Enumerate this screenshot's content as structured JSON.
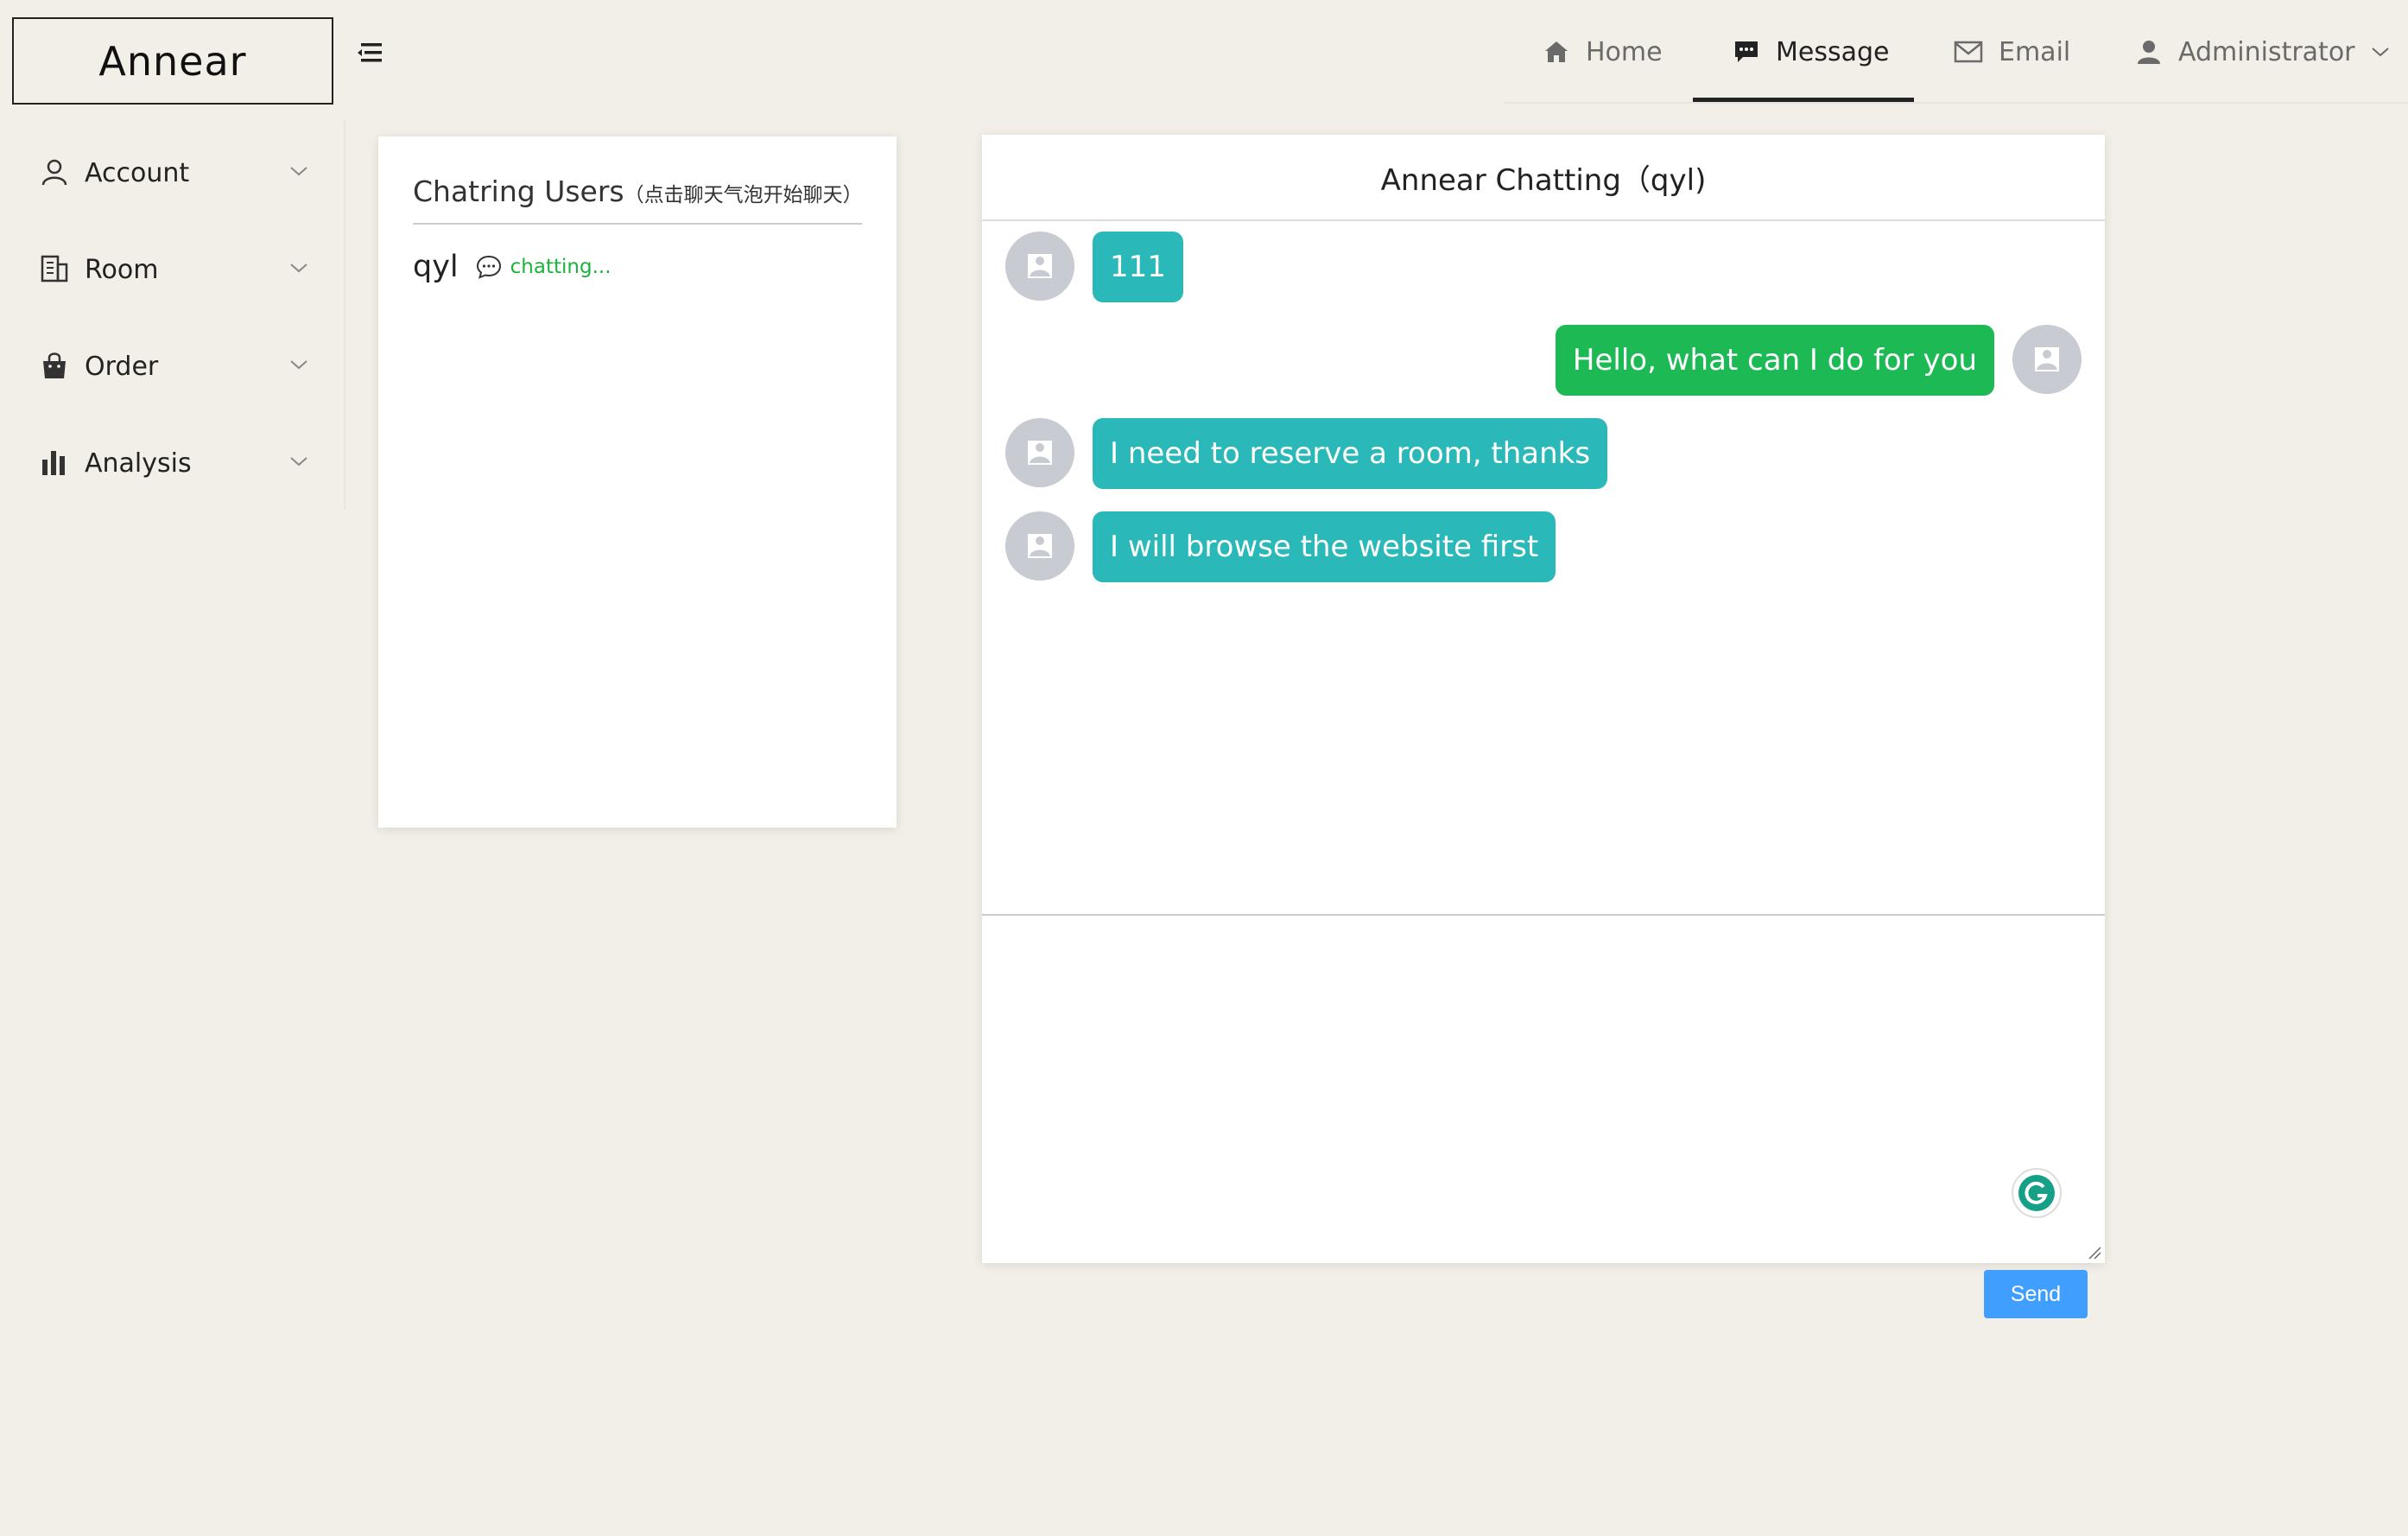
{
  "brand": {
    "logo_text": "Annear"
  },
  "topnav": {
    "items": [
      {
        "label": "Home",
        "icon": "home-icon"
      },
      {
        "label": "Message",
        "icon": "message-icon",
        "active": true
      },
      {
        "label": "Email",
        "icon": "mail-icon"
      },
      {
        "label": "Administrator",
        "icon": "user-icon"
      }
    ]
  },
  "sidebar": {
    "items": [
      {
        "label": "Account",
        "icon": "user-outline-icon"
      },
      {
        "label": "Room",
        "icon": "building-icon"
      },
      {
        "label": "Order",
        "icon": "shopping-bag-icon"
      },
      {
        "label": "Analysis",
        "icon": "bar-chart-icon"
      }
    ]
  },
  "users_panel": {
    "title": "Chatring Users",
    "subtitle": "（点击聊天气泡开始聊天）",
    "users": [
      {
        "name": "qyl",
        "status": "chatting..."
      }
    ]
  },
  "chat": {
    "title": "Annear Chatting（qyl)",
    "messages": [
      {
        "direction": "in",
        "text": "111"
      },
      {
        "direction": "out",
        "text": "Hello, what can I do for you"
      },
      {
        "direction": "in",
        "text": "I need to reserve a room, thanks"
      },
      {
        "direction": "in",
        "text": "I will browse the website first"
      }
    ],
    "input_value": "",
    "send_label": "Send"
  },
  "colors": {
    "background": "#f2eee8",
    "incoming_bubble": "#2ab8b8",
    "outgoing_bubble": "#1cb955",
    "status_green": "#1cb33c",
    "send_button": "#409eff",
    "avatar_gray": "#c8cbd2"
  }
}
